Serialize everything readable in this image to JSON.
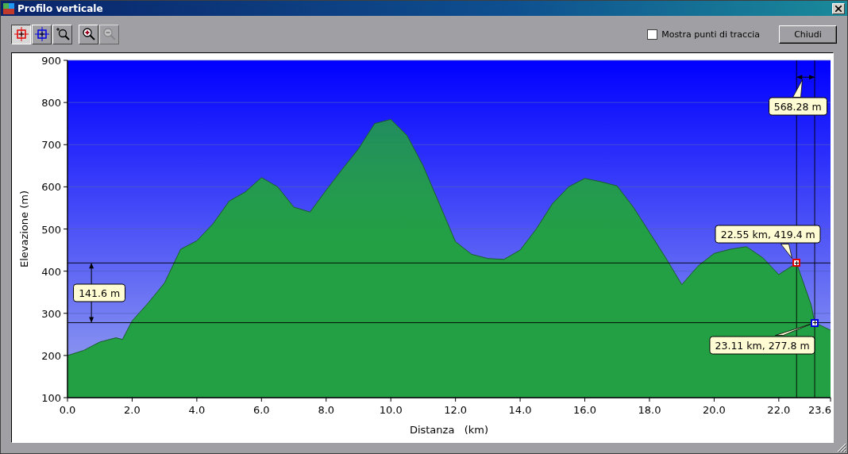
{
  "window": {
    "title": "Profilo verticale"
  },
  "tools": [
    {
      "selected": true,
      "disabled": false
    },
    {
      "selected": false,
      "disabled": false
    },
    {
      "selected": false,
      "disabled": false
    },
    {
      "selected": false,
      "disabled": false
    },
    {
      "selected": false,
      "disabled": true
    }
  ],
  "show_points": {
    "label": "Mostra punti di traccia",
    "checked": false
  },
  "close_button": "Chiudi",
  "chart_data": {
    "type": "area",
    "xlabel": "Distanza   (km)",
    "ylabel": "Elevazione (m)",
    "xlim": [
      0,
      23.6
    ],
    "ylim": [
      100,
      900
    ],
    "xticks": [
      {
        "value": 0,
        "label": "0.0"
      },
      {
        "value": 2,
        "label": "2.0"
      },
      {
        "value": 4,
        "label": "4.0"
      },
      {
        "value": 6,
        "label": "6.0"
      },
      {
        "value": 8,
        "label": "8.0"
      },
      {
        "value": 10,
        "label": "10.0"
      },
      {
        "value": 12,
        "label": "12.0"
      },
      {
        "value": 14,
        "label": "14.0"
      },
      {
        "value": 16,
        "label": "16.0"
      },
      {
        "value": 18,
        "label": "18.0"
      },
      {
        "value": 20,
        "label": "20.0"
      },
      {
        "value": 22,
        "label": "22.0"
      },
      {
        "value": 23.6,
        "label": "23.6"
      }
    ],
    "yticks": [
      100,
      200,
      300,
      400,
      500,
      600,
      700,
      800,
      900
    ],
    "x": [
      0,
      0.5,
      1,
      1.5,
      1.7,
      2,
      2.5,
      3,
      3.5,
      4,
      4.5,
      5,
      5.5,
      6,
      6.5,
      7,
      7.5,
      8,
      8.5,
      9,
      9.5,
      10,
      10.5,
      11,
      11.5,
      12,
      12.5,
      13,
      13.5,
      14,
      14.5,
      15,
      15.5,
      16,
      16.5,
      17,
      17.5,
      18,
      18.5,
      19,
      19.5,
      20,
      20.5,
      21,
      21.5,
      22,
      22.55,
      23,
      23.11,
      23.6
    ],
    "grid": true,
    "series": [
      {
        "color": "#22a043",
        "values": [
          200,
          212,
          232,
          242,
          238,
          282,
          325,
          372,
          452,
          472,
          512,
          566,
          588,
          622,
          600,
          552,
          540,
          592,
          642,
          690,
          750,
          760,
          722,
          650,
          560,
          470,
          440,
          430,
          428,
          450,
          500,
          560,
          600,
          620,
          612,
          602,
          552,
          492,
          432,
          368,
          412,
          442,
          452,
          458,
          432,
          392,
          419,
          320,
          278,
          260
        ]
      }
    ]
  },
  "cursors": [
    {
      "label": "22.55 km, 419.4 m",
      "color": "#e00000"
    },
    {
      "label": "23.11 km, 277.8 m",
      "color": "#0000e0"
    }
  ],
  "measures": [
    {
      "label": "141.6 m"
    },
    {
      "label": "568.28 m"
    }
  ]
}
